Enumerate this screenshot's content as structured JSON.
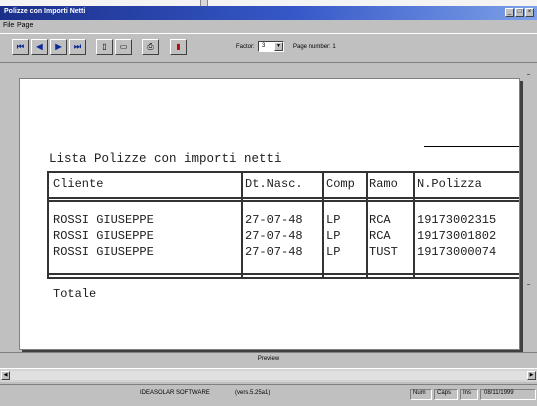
{
  "window": {
    "title": "Polizze con Importi Netti",
    "btn_min": "_",
    "btn_max": "□",
    "btn_close": "×"
  },
  "menu": [
    {
      "label": "File",
      "mnemonic": "F"
    },
    {
      "label": "Page",
      "mnemonic": "P"
    }
  ],
  "toolbar": {
    "first_icon": "⏮",
    "prev_icon": "◀",
    "next_icon": "▶",
    "last_icon": "⏭",
    "page_icon": "▯",
    "pagewidth_icon": "▭",
    "print_icon": "⎙",
    "exit_icon": "▮",
    "zoom_label": "Factor:",
    "zoom_value": "3",
    "dropdown_icon": "▼",
    "page_number": "Page number: 1"
  },
  "report": {
    "title": "Lista Polizze con importi netti",
    "columns": [
      "Cliente",
      "Dt.Nasc.",
      "Comp",
      "Ramo",
      "N.Polizza"
    ],
    "rows": [
      {
        "cliente": "ROSSI GIUSEPPE",
        "dt_nasc": "27-07-48",
        "comp": "LP",
        "ramo": "RCA",
        "polizza": "19173002315"
      },
      {
        "cliente": "ROSSI GIUSEPPE",
        "dt_nasc": "27-07-48",
        "comp": "LP",
        "ramo": "RCA",
        "polizza": "19173001802"
      },
      {
        "cliente": "ROSSI GIUSEPPE",
        "dt_nasc": "27-07-48",
        "comp": "LP",
        "ramo": "TUST",
        "polizza": "19173000074"
      }
    ],
    "total_label": "Totale"
  },
  "preview_label": "Preview",
  "scroll": {
    "left_icon": "◀",
    "right_icon": "▶"
  },
  "status": {
    "company": "IDEASOLAR SOFTWARE",
    "version": "(vers.5.25a1)",
    "num": "Num",
    "caps": "Caps",
    "ins": "Ins",
    "date": "08/11/1999"
  },
  "colors": {
    "title_gradient_start": "#1a2f8a",
    "title_gradient_end": "#7da0e8",
    "workspace": "#c0c0c0",
    "paper": "#ffffff"
  }
}
